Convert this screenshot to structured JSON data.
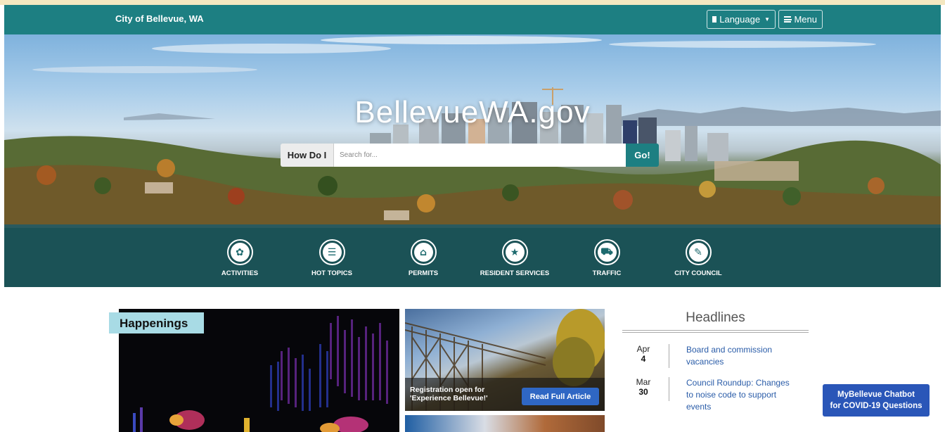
{
  "header": {
    "brand": "City of Bellevue, WA",
    "language_label": "Language",
    "menu_label": "Menu"
  },
  "hero": {
    "title": "BellevueWA.gov",
    "search": {
      "howdoi_label": "How Do I",
      "placeholder": "Search for...",
      "go_label": "Go!"
    }
  },
  "quicklinks": [
    {
      "label": "ACTIVITIES",
      "icon": "activities-icon"
    },
    {
      "label": "HOT TOPICS",
      "icon": "hot-topics-icon"
    },
    {
      "label": "PERMITS",
      "icon": "permits-icon"
    },
    {
      "label": "RESIDENT SERVICES",
      "icon": "star-icon"
    },
    {
      "label": "TRAFFIC",
      "icon": "traffic-icon"
    },
    {
      "label": "CITY COUNCIL",
      "icon": "city-council-icon"
    }
  ],
  "happenings": {
    "label": "Happenings"
  },
  "article": {
    "caption": "Registration open for 'Experience Bellevue!'",
    "read_label": "Read Full Article"
  },
  "headlines": {
    "title": "Headlines",
    "items": [
      {
        "month": "Apr",
        "day": "4",
        "text": "Board and commission vacancies"
      },
      {
        "month": "Mar",
        "day": "30",
        "text": "Council Roundup: Changes to noise code to support events"
      }
    ]
  },
  "chatbot": {
    "line1": "MyBellevue Chatbot",
    "line2": "for COVID-19 Questions"
  },
  "colors": {
    "brand_teal": "#1d7f82",
    "link_blue": "#2a5ca8",
    "button_blue": "#2f67c4",
    "happenings_tag": "#a8dbe5"
  }
}
